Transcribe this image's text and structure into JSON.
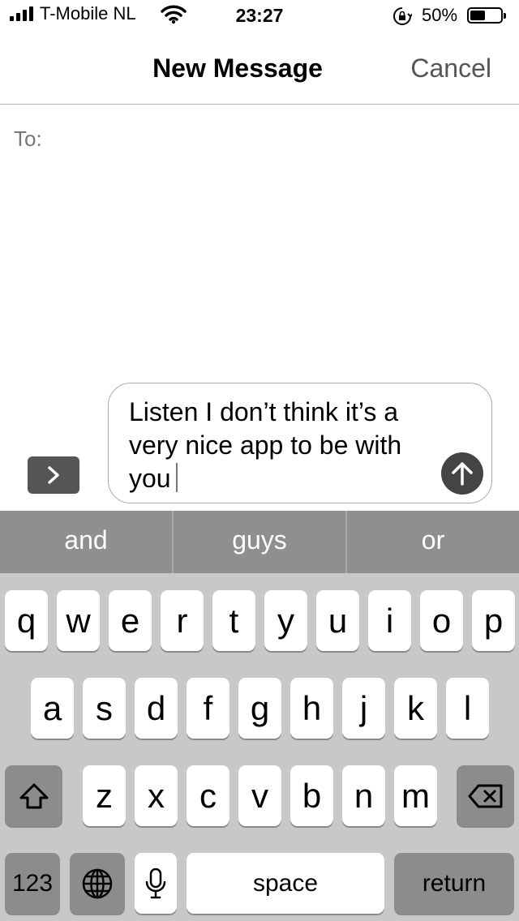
{
  "status_bar": {
    "carrier": "T-Mobile NL",
    "time": "23:27",
    "battery_percent": "50%",
    "battery_level": 0.5
  },
  "nav": {
    "title": "New Message",
    "cancel_label": "Cancel"
  },
  "to_label": "To:",
  "message": {
    "text": "Listen I don’t think it’s a very nice app to be with you"
  },
  "suggestions": [
    "and",
    "guys",
    "or"
  ],
  "keyboard": {
    "row1": [
      "q",
      "w",
      "e",
      "r",
      "t",
      "y",
      "u",
      "i",
      "o",
      "p"
    ],
    "row2": [
      "a",
      "s",
      "d",
      "f",
      "g",
      "h",
      "j",
      "k",
      "l"
    ],
    "row3": [
      "z",
      "x",
      "c",
      "v",
      "b",
      "n",
      "m"
    ],
    "numbers_label": "123",
    "space_label": "space",
    "return_label": "return"
  }
}
